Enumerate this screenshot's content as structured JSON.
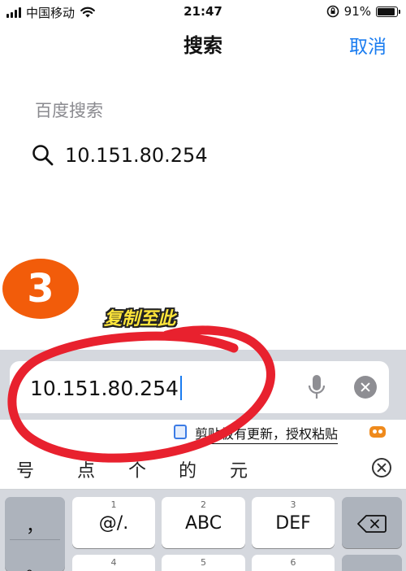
{
  "status_bar": {
    "carrier": "中国移动",
    "time": "21:47",
    "battery_percent": "91%",
    "battery_level": 0.91,
    "icons": [
      "signal-icon",
      "wifi-icon",
      "orientation-lock-icon",
      "battery-icon"
    ]
  },
  "header": {
    "title": "搜索",
    "cancel_label": "取消"
  },
  "suggestions": {
    "section_label": "百度搜索",
    "items": [
      {
        "icon": "search-icon",
        "text": "10.151.80.254"
      }
    ]
  },
  "annotation": {
    "step_number": "3",
    "note": "复制至此",
    "accent_color": "#f25c0a",
    "note_color": "#ffe53a",
    "ring_color": "#e8212e"
  },
  "search_input": {
    "value": "10.151.80.254",
    "icons": [
      "microphone-icon",
      "clear-icon"
    ]
  },
  "clipboard_prompt": {
    "text": "剪贴板有更新，授权粘贴",
    "icons": [
      "clipboard-icon",
      "keyboard-bot-icon"
    ]
  },
  "keyboard": {
    "candidates": [
      "号",
      "点",
      "个",
      "的",
      "元"
    ],
    "collapse_icon": "collapse-icon",
    "keys_row1": [
      {
        "num": "",
        "label": "，"
      },
      {
        "num": "1",
        "label": "@/."
      },
      {
        "num": "2",
        "label": "ABC"
      },
      {
        "num": "3",
        "label": "DEF"
      },
      {
        "num": "",
        "label": "backspace"
      }
    ],
    "keys_row2": [
      {
        "num": "",
        "label": "。"
      },
      {
        "num": "4",
        "label": ""
      },
      {
        "num": "5",
        "label": ""
      },
      {
        "num": "6",
        "label": ""
      },
      {
        "num": "",
        "label": ""
      }
    ],
    "accent_color": "#1a7cf0"
  }
}
